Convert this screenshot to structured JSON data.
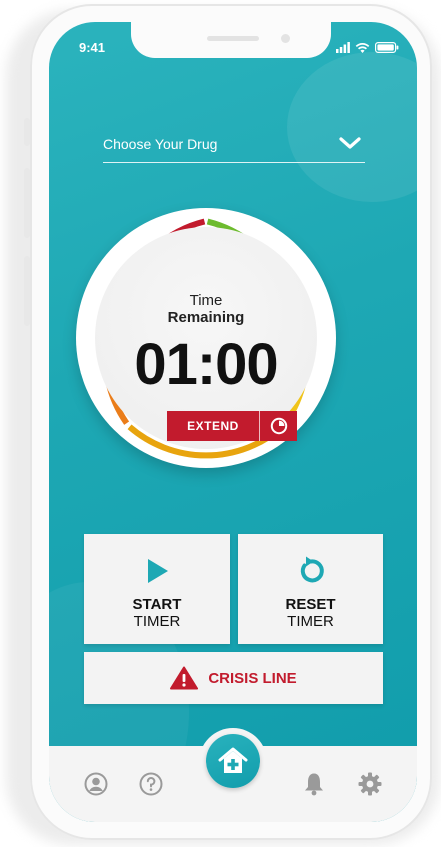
{
  "status_bar": {
    "time": "9:41"
  },
  "drug_select": {
    "label": "Choose Your Drug"
  },
  "timer": {
    "label_line1": "Time",
    "label_line2": "Remaining",
    "value": "01:00",
    "extend_label": "EXTEND"
  },
  "actions": {
    "start": {
      "line1": "START",
      "line2": "TIMER"
    },
    "reset": {
      "line1": "RESET",
      "line2": "TIMER"
    },
    "crisis": {
      "label": "CRISIS LINE"
    }
  },
  "bottom_nav": {
    "items": [
      "profile-icon",
      "help-icon",
      "home-icon",
      "bell-icon",
      "gear-icon"
    ]
  },
  "colors": {
    "teal": "#1ea8b4",
    "red": "#c21b2d",
    "ring": [
      "#c21b2d",
      "#6dbb2e",
      "#f0c419",
      "#e8a40e",
      "#ea7d1a"
    ],
    "card": "#f3f3f3"
  }
}
